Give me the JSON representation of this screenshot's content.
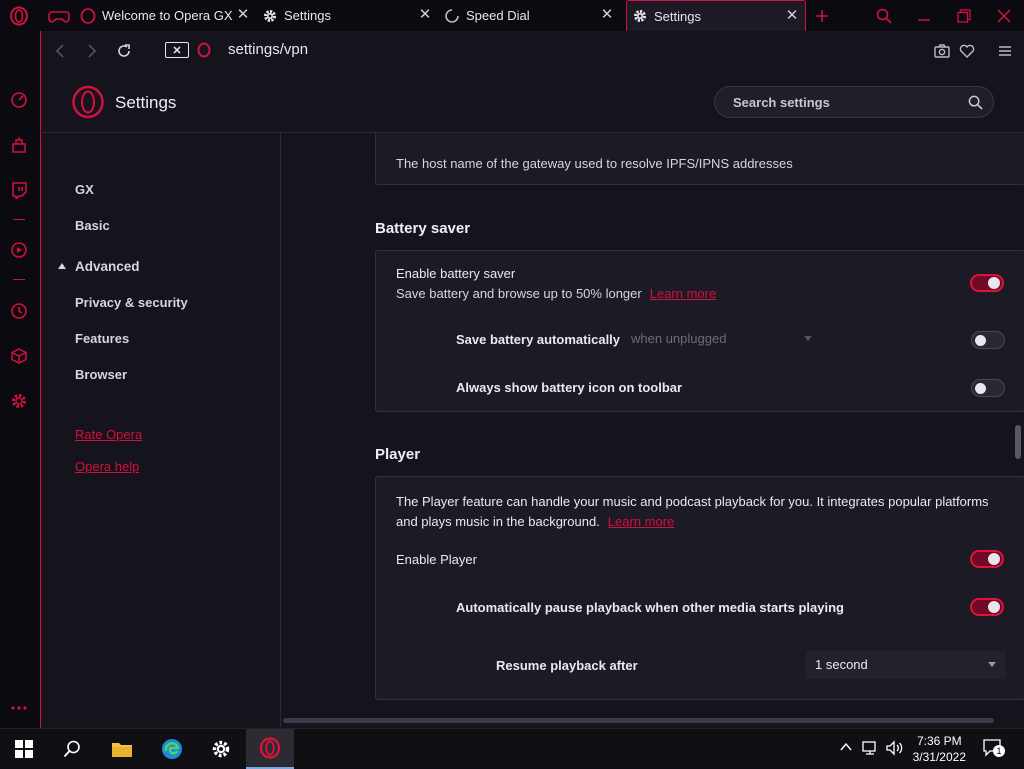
{
  "tabs": [
    {
      "title": "Welcome to Opera GX",
      "icon": "opera-icon"
    },
    {
      "title": "Settings",
      "icon": "gear-icon"
    },
    {
      "title": "Speed Dial",
      "icon": "loading-icon"
    },
    {
      "title": "Settings",
      "icon": "gear-icon",
      "active": true
    }
  ],
  "address": {
    "url": "settings/vpn"
  },
  "header": {
    "title": "Settings",
    "search_placeholder": "Search settings"
  },
  "nav": {
    "items": [
      "GX",
      "Basic",
      "Advanced",
      "Privacy & security",
      "Features",
      "Browser"
    ],
    "links": [
      "Rate Opera",
      "Opera help"
    ]
  },
  "ipfs": {
    "description": "The host name of the gateway used to resolve IPFS/IPNS addresses"
  },
  "battery": {
    "title": "Battery saver",
    "enable_label": "Enable battery saver",
    "enable_desc": "Save battery and browse up to 50% longer",
    "learn_more": "Learn more",
    "enable_on": true,
    "auto_label": "Save battery automatically",
    "auto_select": "when unplugged",
    "auto_on": false,
    "icon_label": "Always show battery icon on toolbar",
    "icon_on": false
  },
  "player": {
    "title": "Player",
    "desc_line1": "The Player feature can handle your music and podcast playback for you. It integrates popular platforms",
    "desc_line2": "and plays music in the background.",
    "learn_more": "Learn more",
    "enable_label": "Enable Player",
    "enable_on": true,
    "pause_label": "Automatically pause playback when other media starts playing",
    "pause_on": true,
    "resume_label": "Resume playback after",
    "resume_select": "1 second"
  },
  "taskbar": {
    "time": "7:36 PM",
    "date": "3/31/2022",
    "notifications": "1"
  },
  "colors": {
    "accent": "#d3103e",
    "background": "#15131c",
    "card": "#1c1a24"
  }
}
